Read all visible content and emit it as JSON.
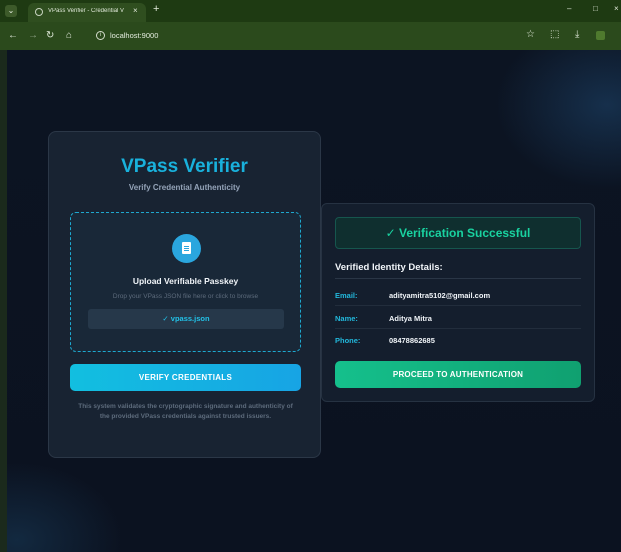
{
  "browser": {
    "tab_title": "VPass Verifier - Credential Verif",
    "tab_close": "×",
    "new_tab": "+",
    "url": "localhost:9000",
    "controls": {
      "minimize": "–",
      "maximize": "□",
      "close": "×"
    }
  },
  "app": {
    "title": "VPass Verifier",
    "subtitle": "Verify Credential Authenticity"
  },
  "upload": {
    "title": "Upload Verifiable Passkey",
    "hint": "Drop your VPass JSON file here or click to browse",
    "file_chip": "✓ vpass.json"
  },
  "verify_button": "VERIFY CREDENTIALS",
  "footnote": "This system validates the cryptographic signature and authenticity of the provided VPass credentials against trusted issuers.",
  "result": {
    "banner": "✓ Verification Successful",
    "details_title": "Verified Identity Details:",
    "fields": [
      {
        "label": "Email:",
        "value": "adityamitra5102@gmail.com"
      },
      {
        "label": "Name:",
        "value": "Aditya Mitra"
      },
      {
        "label": "Phone:",
        "value": "08478862685"
      }
    ],
    "proceed_button": "PROCEED TO AUTHENTICATION"
  },
  "colors": {
    "accent_cyan": "#19b1dc",
    "success_green": "#19d2a0",
    "background": "#0b1220"
  }
}
